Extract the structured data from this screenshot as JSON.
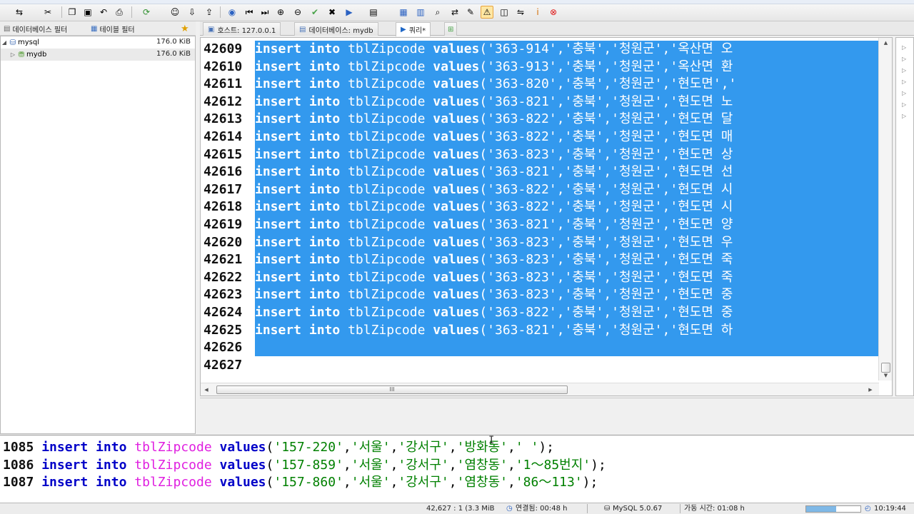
{
  "toolbar": {
    "icons": [
      "connect-icon",
      "disconnect-icon",
      "copy-icon",
      "paste-icon",
      "undo-icon",
      "print-icon",
      "refresh-icon",
      "user-manager-icon",
      "import-icon",
      "export-icon",
      "help-icon",
      "first-icon",
      "last-icon",
      "add-row-icon",
      "delete-row-icon",
      "apply-icon",
      "cancel-icon",
      "run-query-icon",
      "query-options-icon",
      "save-icon",
      "save-all-icon",
      "find-icon",
      "replace-icon",
      "edit-icon",
      "sql-help-icon",
      "ox-icon",
      "filter-icon",
      "info-icon",
      "stop-icon"
    ]
  },
  "left_panel": {
    "tabs": [
      {
        "label": "데이터베이스 필터",
        "icon": "database-filter-icon"
      },
      {
        "label": "테이블 필터",
        "icon": "table-filter-icon"
      }
    ],
    "star_icon": "favorite-star-icon",
    "tree": [
      {
        "label": "mysql",
        "size": "176.0 KiB",
        "expanded": true
      },
      {
        "label": "mydb",
        "size": "176.0 KiB",
        "expanded": false
      }
    ]
  },
  "doc_tabs": [
    {
      "label": "호스트: 127.0.0.1",
      "icon": "host-icon"
    },
    {
      "label": "데이터베이스: mydb",
      "icon": "database-icon"
    },
    {
      "label": "쿼리*",
      "icon": "query-play-icon",
      "active": true
    }
  ],
  "editor": {
    "gutter": [
      "42609",
      "42610",
      "42611",
      "42612",
      "42613",
      "42614",
      "42615",
      "42616",
      "42617",
      "42618",
      "42619",
      "42620",
      "42621",
      "42622",
      "42623",
      "42624",
      "42625",
      "42626",
      "42627"
    ],
    "lines": [
      {
        "kw1": "insert",
        "kw2": "into",
        "table": "tblZipcode",
        "kw3": "values",
        "rest": "('363-914','충북','청원군','옥산면 오"
      },
      {
        "kw1": "insert",
        "kw2": "into",
        "table": "tblZipcode",
        "kw3": "values",
        "rest": "('363-913','충북','청원군','옥산면 환"
      },
      {
        "kw1": "insert",
        "kw2": "into",
        "table": "tblZipcode",
        "kw3": "values",
        "rest": "('363-820','충북','청원군','현도면','"
      },
      {
        "kw1": "insert",
        "kw2": "into",
        "table": "tblZipcode",
        "kw3": "values",
        "rest": "('363-821','충북','청원군','현도면 노"
      },
      {
        "kw1": "insert",
        "kw2": "into",
        "table": "tblZipcode",
        "kw3": "values",
        "rest": "('363-822','충북','청원군','현도면 달"
      },
      {
        "kw1": "insert",
        "kw2": "into",
        "table": "tblZipcode",
        "kw3": "values",
        "rest": "('363-822','충북','청원군','현도면 매"
      },
      {
        "kw1": "insert",
        "kw2": "into",
        "table": "tblZipcode",
        "kw3": "values",
        "rest": "('363-823','충북','청원군','현도면 상"
      },
      {
        "kw1": "insert",
        "kw2": "into",
        "table": "tblZipcode",
        "kw3": "values",
        "rest": "('363-821','충북','청원군','현도면 선"
      },
      {
        "kw1": "insert",
        "kw2": "into",
        "table": "tblZipcode",
        "kw3": "values",
        "rest": "('363-822','충북','청원군','현도면 시"
      },
      {
        "kw1": "insert",
        "kw2": "into",
        "table": "tblZipcode",
        "kw3": "values",
        "rest": "('363-822','충북','청원군','현도면 시"
      },
      {
        "kw1": "insert",
        "kw2": "into",
        "table": "tblZipcode",
        "kw3": "values",
        "rest": "('363-821','충북','청원군','현도면 양"
      },
      {
        "kw1": "insert",
        "kw2": "into",
        "table": "tblZipcode",
        "kw3": "values",
        "rest": "('363-823','충북','청원군','현도면 우"
      },
      {
        "kw1": "insert",
        "kw2": "into",
        "table": "tblZipcode",
        "kw3": "values",
        "rest": "('363-823','충북','청원군','현도면 죽"
      },
      {
        "kw1": "insert",
        "kw2": "into",
        "table": "tblZipcode",
        "kw3": "values",
        "rest": "('363-823','충북','청원군','현도면 죽"
      },
      {
        "kw1": "insert",
        "kw2": "into",
        "table": "tblZipcode",
        "kw3": "values",
        "rest": "('363-823','충북','청원군','현도면 중"
      },
      {
        "kw1": "insert",
        "kw2": "into",
        "table": "tblZipcode",
        "kw3": "values",
        "rest": "('363-822','충북','청원군','현도면 중"
      },
      {
        "kw1": "insert",
        "kw2": "into",
        "table": "tblZipcode",
        "kw3": "values",
        "rest": "('363-821','충북','청원군','현도면 하"
      }
    ],
    "hscroll_grip": "III",
    "selection_color": "#3399ee"
  },
  "help_box": {
    "lines": [
      {
        "num": "1085",
        "kw1": "insert",
        "kw2": "into",
        "table": "tblZipcode",
        "kw3": "values",
        "open": "(",
        "vals": [
          "'157-220'",
          "'서울'",
          "'강서구'",
          "'방화동'",
          "' '"
        ],
        "close": ");"
      },
      {
        "num": "1086",
        "kw1": "insert",
        "kw2": "into",
        "table": "tblZipcode",
        "kw3": "values",
        "open": "(",
        "vals": [
          "'157-859'",
          "'서울'",
          "'강서구'",
          "'염창동'",
          "'1～85번지'"
        ],
        "close": ");"
      },
      {
        "num": "1087",
        "kw1": "insert",
        "kw2": "into",
        "table": "tblZipcode",
        "kw3": "values",
        "open": "(",
        "vals": [
          "'157-860'",
          "'서울'",
          "'강서구'",
          "'염창동'",
          "'86～113'"
        ],
        "close": ");"
      }
    ],
    "colors": {
      "keyword": "#0000c8",
      "table": "#e020e0",
      "string": "#008000"
    }
  },
  "status_bar": {
    "position": "42,627 : 1 (3.3 MiB",
    "connected": "연결됨: 00:48 h",
    "server": "MySQL 5.0.67",
    "uptime": "가동 시간: 01:08 h",
    "progress": 0.55,
    "time": "10:19:44"
  }
}
